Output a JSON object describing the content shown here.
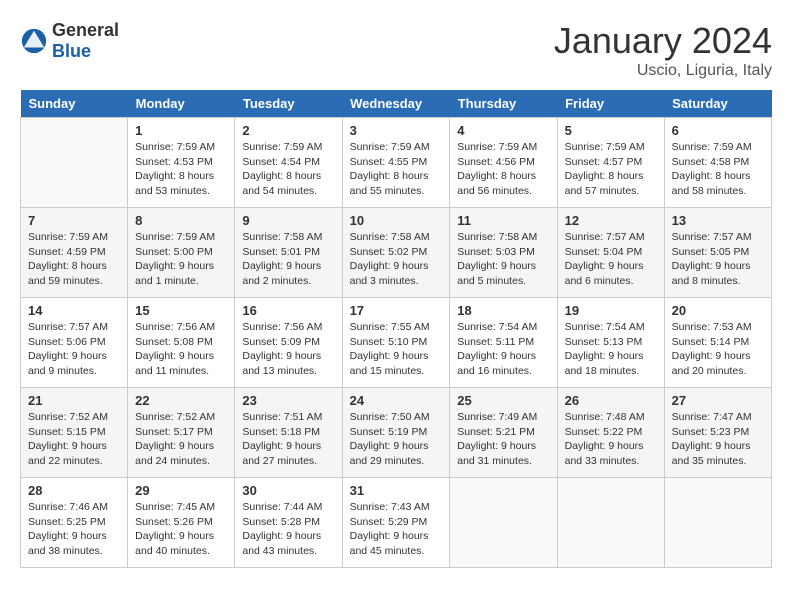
{
  "header": {
    "logo_general": "General",
    "logo_blue": "Blue",
    "title": "January 2024",
    "subtitle": "Uscio, Liguria, Italy"
  },
  "days_of_week": [
    "Sunday",
    "Monday",
    "Tuesday",
    "Wednesday",
    "Thursday",
    "Friday",
    "Saturday"
  ],
  "weeks": [
    [
      {
        "day": "",
        "sunrise": "",
        "sunset": "",
        "daylight": ""
      },
      {
        "day": "1",
        "sunrise": "Sunrise: 7:59 AM",
        "sunset": "Sunset: 4:53 PM",
        "daylight": "Daylight: 8 hours and 53 minutes."
      },
      {
        "day": "2",
        "sunrise": "Sunrise: 7:59 AM",
        "sunset": "Sunset: 4:54 PM",
        "daylight": "Daylight: 8 hours and 54 minutes."
      },
      {
        "day": "3",
        "sunrise": "Sunrise: 7:59 AM",
        "sunset": "Sunset: 4:55 PM",
        "daylight": "Daylight: 8 hours and 55 minutes."
      },
      {
        "day": "4",
        "sunrise": "Sunrise: 7:59 AM",
        "sunset": "Sunset: 4:56 PM",
        "daylight": "Daylight: 8 hours and 56 minutes."
      },
      {
        "day": "5",
        "sunrise": "Sunrise: 7:59 AM",
        "sunset": "Sunset: 4:57 PM",
        "daylight": "Daylight: 8 hours and 57 minutes."
      },
      {
        "day": "6",
        "sunrise": "Sunrise: 7:59 AM",
        "sunset": "Sunset: 4:58 PM",
        "daylight": "Daylight: 8 hours and 58 minutes."
      }
    ],
    [
      {
        "day": "7",
        "sunrise": "Sunrise: 7:59 AM",
        "sunset": "Sunset: 4:59 PM",
        "daylight": "Daylight: 8 hours and 59 minutes."
      },
      {
        "day": "8",
        "sunrise": "Sunrise: 7:59 AM",
        "sunset": "Sunset: 5:00 PM",
        "daylight": "Daylight: 9 hours and 1 minute."
      },
      {
        "day": "9",
        "sunrise": "Sunrise: 7:58 AM",
        "sunset": "Sunset: 5:01 PM",
        "daylight": "Daylight: 9 hours and 2 minutes."
      },
      {
        "day": "10",
        "sunrise": "Sunrise: 7:58 AM",
        "sunset": "Sunset: 5:02 PM",
        "daylight": "Daylight: 9 hours and 3 minutes."
      },
      {
        "day": "11",
        "sunrise": "Sunrise: 7:58 AM",
        "sunset": "Sunset: 5:03 PM",
        "daylight": "Daylight: 9 hours and 5 minutes."
      },
      {
        "day": "12",
        "sunrise": "Sunrise: 7:57 AM",
        "sunset": "Sunset: 5:04 PM",
        "daylight": "Daylight: 9 hours and 6 minutes."
      },
      {
        "day": "13",
        "sunrise": "Sunrise: 7:57 AM",
        "sunset": "Sunset: 5:05 PM",
        "daylight": "Daylight: 9 hours and 8 minutes."
      }
    ],
    [
      {
        "day": "14",
        "sunrise": "Sunrise: 7:57 AM",
        "sunset": "Sunset: 5:06 PM",
        "daylight": "Daylight: 9 hours and 9 minutes."
      },
      {
        "day": "15",
        "sunrise": "Sunrise: 7:56 AM",
        "sunset": "Sunset: 5:08 PM",
        "daylight": "Daylight: 9 hours and 11 minutes."
      },
      {
        "day": "16",
        "sunrise": "Sunrise: 7:56 AM",
        "sunset": "Sunset: 5:09 PM",
        "daylight": "Daylight: 9 hours and 13 minutes."
      },
      {
        "day": "17",
        "sunrise": "Sunrise: 7:55 AM",
        "sunset": "Sunset: 5:10 PM",
        "daylight": "Daylight: 9 hours and 15 minutes."
      },
      {
        "day": "18",
        "sunrise": "Sunrise: 7:54 AM",
        "sunset": "Sunset: 5:11 PM",
        "daylight": "Daylight: 9 hours and 16 minutes."
      },
      {
        "day": "19",
        "sunrise": "Sunrise: 7:54 AM",
        "sunset": "Sunset: 5:13 PM",
        "daylight": "Daylight: 9 hours and 18 minutes."
      },
      {
        "day": "20",
        "sunrise": "Sunrise: 7:53 AM",
        "sunset": "Sunset: 5:14 PM",
        "daylight": "Daylight: 9 hours and 20 minutes."
      }
    ],
    [
      {
        "day": "21",
        "sunrise": "Sunrise: 7:52 AM",
        "sunset": "Sunset: 5:15 PM",
        "daylight": "Daylight: 9 hours and 22 minutes."
      },
      {
        "day": "22",
        "sunrise": "Sunrise: 7:52 AM",
        "sunset": "Sunset: 5:17 PM",
        "daylight": "Daylight: 9 hours and 24 minutes."
      },
      {
        "day": "23",
        "sunrise": "Sunrise: 7:51 AM",
        "sunset": "Sunset: 5:18 PM",
        "daylight": "Daylight: 9 hours and 27 minutes."
      },
      {
        "day": "24",
        "sunrise": "Sunrise: 7:50 AM",
        "sunset": "Sunset: 5:19 PM",
        "daylight": "Daylight: 9 hours and 29 minutes."
      },
      {
        "day": "25",
        "sunrise": "Sunrise: 7:49 AM",
        "sunset": "Sunset: 5:21 PM",
        "daylight": "Daylight: 9 hours and 31 minutes."
      },
      {
        "day": "26",
        "sunrise": "Sunrise: 7:48 AM",
        "sunset": "Sunset: 5:22 PM",
        "daylight": "Daylight: 9 hours and 33 minutes."
      },
      {
        "day": "27",
        "sunrise": "Sunrise: 7:47 AM",
        "sunset": "Sunset: 5:23 PM",
        "daylight": "Daylight: 9 hours and 35 minutes."
      }
    ],
    [
      {
        "day": "28",
        "sunrise": "Sunrise: 7:46 AM",
        "sunset": "Sunset: 5:25 PM",
        "daylight": "Daylight: 9 hours and 38 minutes."
      },
      {
        "day": "29",
        "sunrise": "Sunrise: 7:45 AM",
        "sunset": "Sunset: 5:26 PM",
        "daylight": "Daylight: 9 hours and 40 minutes."
      },
      {
        "day": "30",
        "sunrise": "Sunrise: 7:44 AM",
        "sunset": "Sunset: 5:28 PM",
        "daylight": "Daylight: 9 hours and 43 minutes."
      },
      {
        "day": "31",
        "sunrise": "Sunrise: 7:43 AM",
        "sunset": "Sunset: 5:29 PM",
        "daylight": "Daylight: 9 hours and 45 minutes."
      },
      {
        "day": "",
        "sunrise": "",
        "sunset": "",
        "daylight": ""
      },
      {
        "day": "",
        "sunrise": "",
        "sunset": "",
        "daylight": ""
      },
      {
        "day": "",
        "sunrise": "",
        "sunset": "",
        "daylight": ""
      }
    ]
  ]
}
